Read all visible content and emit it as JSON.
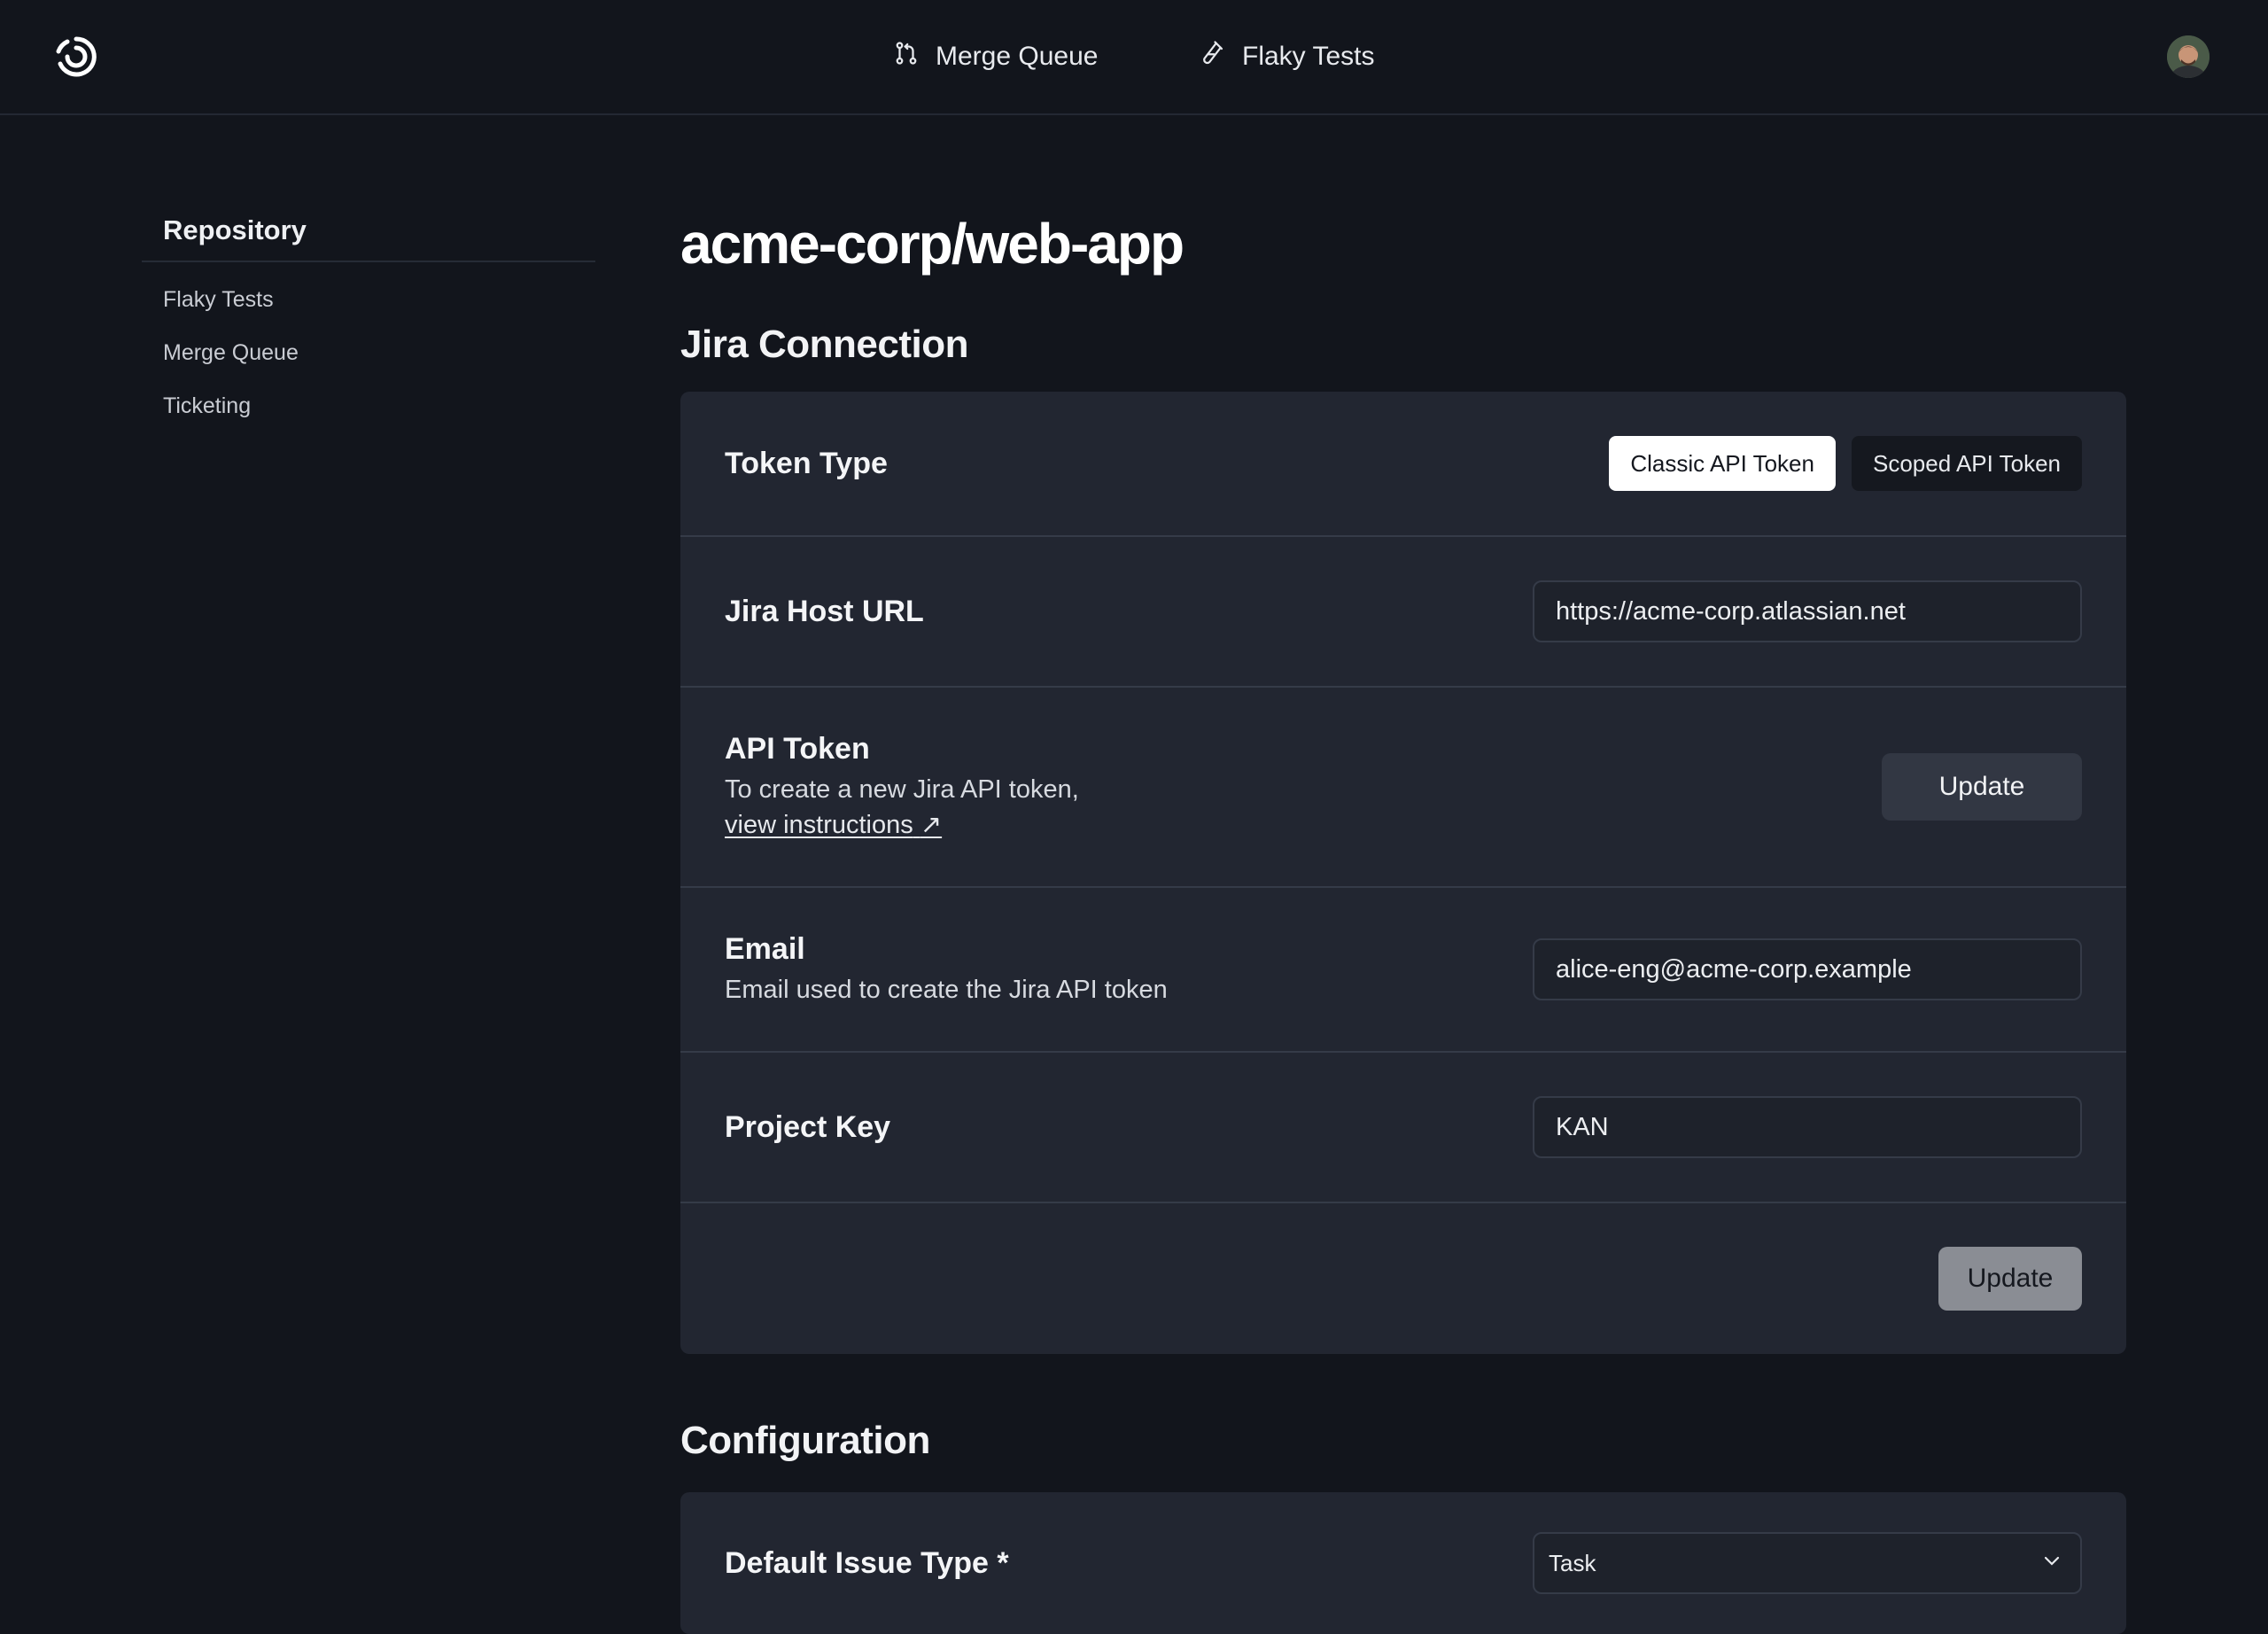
{
  "header": {
    "nav": [
      {
        "label": "Merge Queue",
        "icon": "git-pull-request-icon"
      },
      {
        "label": "Flaky Tests",
        "icon": "test-tube-icon"
      }
    ],
    "avatar_icon": "user-avatar"
  },
  "sidebar": {
    "heading": "Repository",
    "items": [
      {
        "label": "Flaky Tests"
      },
      {
        "label": "Merge Queue"
      },
      {
        "label": "Ticketing"
      }
    ]
  },
  "main": {
    "page_title": "acme-corp/web-app",
    "jira": {
      "section_title": "Jira Connection",
      "token_type": {
        "label": "Token Type",
        "options": [
          "Classic API Token",
          "Scoped API Token"
        ],
        "selected": "Classic API Token"
      },
      "host_url": {
        "label": "Jira Host URL",
        "value": "https://acme-corp.atlassian.net"
      },
      "api_token": {
        "label": "API Token",
        "desc": "To create a new Jira API token,",
        "link": "view instructions",
        "button": "Update"
      },
      "email": {
        "label": "Email",
        "desc": "Email used to create the Jira API token",
        "value": "alice-eng@acme-corp.example"
      },
      "project_key": {
        "label": "Project Key",
        "value": "KAN"
      },
      "submit": "Update"
    },
    "configuration": {
      "section_title": "Configuration",
      "default_issue_type": {
        "label": "Default Issue Type *",
        "value": "Task"
      }
    }
  },
  "colors": {
    "background": "#12151c",
    "card": "#222631",
    "border": "#353b48",
    "accent_white": "#ffffff"
  }
}
